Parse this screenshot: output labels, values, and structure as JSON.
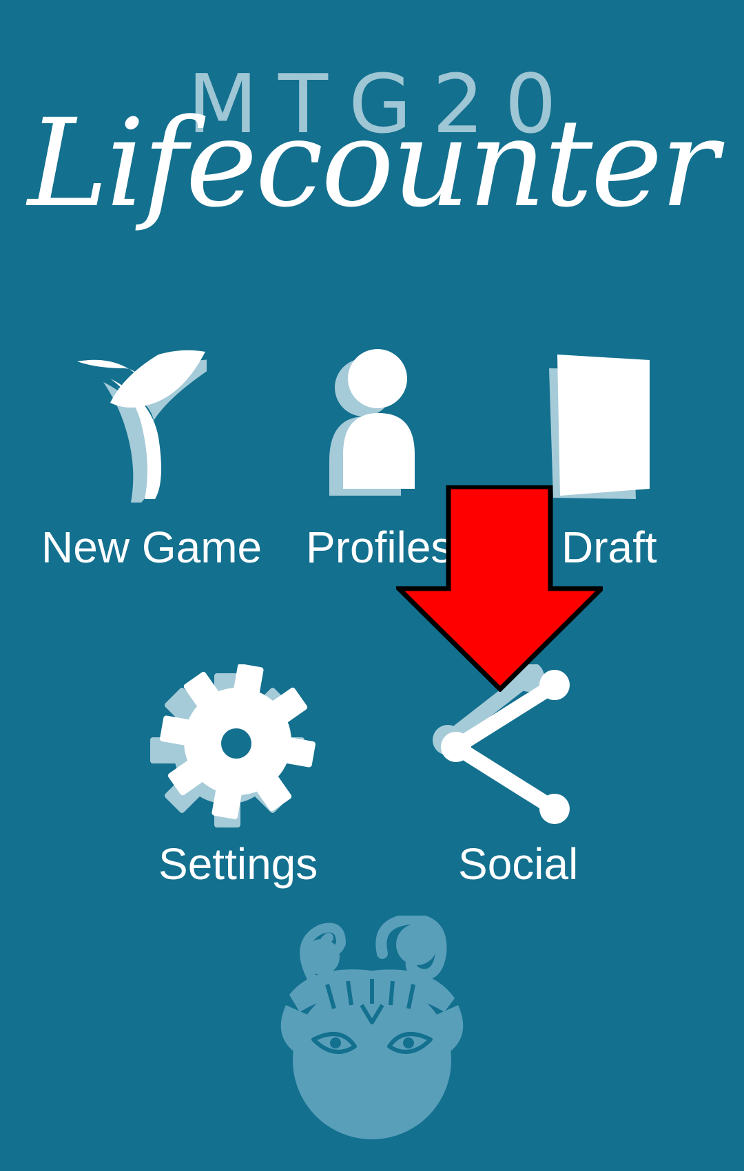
{
  "logo": {
    "top": "MTG20",
    "main": "Lifecounter"
  },
  "colors": {
    "background": "#13708f",
    "icon": "#ffffff",
    "icon_shadow": "#a6cbd8",
    "arrow": "#ff0000",
    "mascot": "#5a9fba"
  },
  "menu": {
    "items": [
      {
        "label": "New Game",
        "icon": "sprout-icon"
      },
      {
        "label": "Profiles",
        "icon": "person-icon"
      },
      {
        "label": "Draft",
        "icon": "card-icon"
      },
      {
        "label": "Settings",
        "icon": "gear-icon"
      },
      {
        "label": "Social",
        "icon": "share-icon"
      }
    ]
  },
  "annotation": {
    "icon": "arrow-down-icon"
  },
  "mascot": {
    "icon": "goblin-mascot-icon"
  }
}
